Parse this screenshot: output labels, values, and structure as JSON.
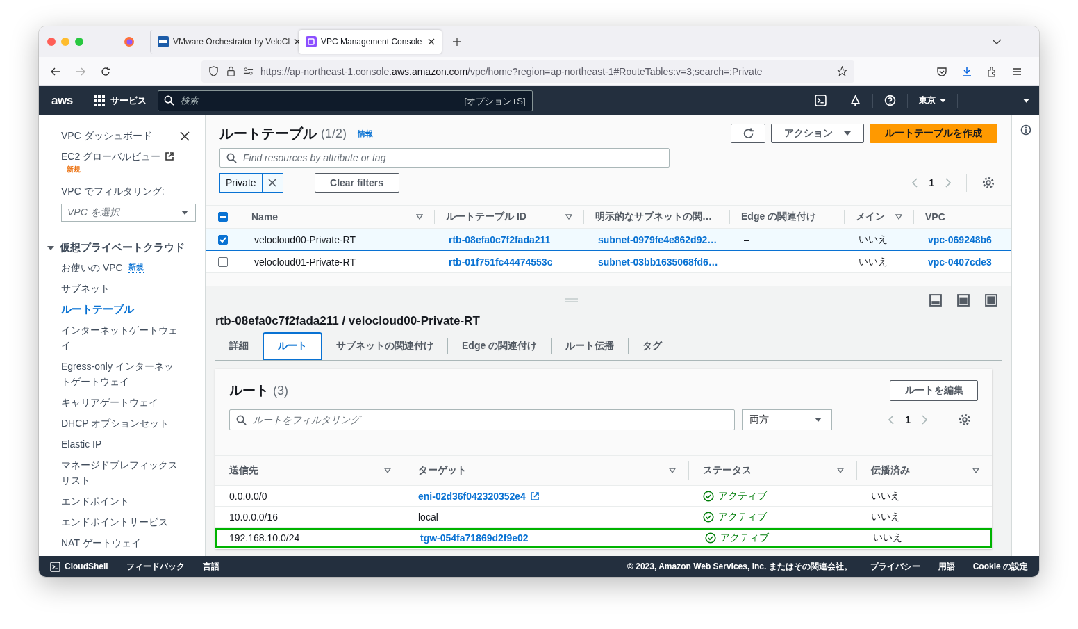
{
  "browser": {
    "tabs": [
      {
        "title": "VMware Orchestrator by VeloCl",
        "selected": false
      },
      {
        "title": "VPC Management Console",
        "selected": true
      }
    ],
    "url": "https://ap-northeast-1.console.**aws.amazon.com**/vpc/home?region=ap-northeast-1#RouteTables:v=3;search=:Private"
  },
  "topnav": {
    "logo": "aws",
    "services": "サービス",
    "search_placeholder": "検索",
    "search_shortcut": "[オプション+S]",
    "region": "東京"
  },
  "sidebar": {
    "items": [
      {
        "label": "VPC ダッシュボード",
        "kind": "link"
      },
      {
        "label": "EC2 グローバルビュー",
        "kind": "external",
        "badge": "新規"
      }
    ],
    "filter_label": "VPC でフィルタリング:",
    "filter_placeholder": "VPC を選択",
    "section": {
      "label": "仮想プライベートクラウド",
      "expanded": true,
      "children": [
        {
          "label": "お使いの VPC",
          "badge": "新規",
          "selected": false
        },
        {
          "label": "サブネット",
          "selected": false
        },
        {
          "label": "ルートテーブル",
          "selected": true
        },
        {
          "label": "インターネットゲートウェイ",
          "selected": false
        },
        {
          "label": "Egress-only インターネットゲートウェイ",
          "selected": false
        },
        {
          "label": "キャリアゲートウェイ",
          "selected": false
        },
        {
          "label": "DHCP オプションセット",
          "selected": false
        },
        {
          "label": "Elastic IP",
          "selected": false
        },
        {
          "label": "マネージドプレフィックスリスト",
          "selected": false
        },
        {
          "label": "エンドポイント",
          "selected": false
        },
        {
          "label": "エンドポイントサービス",
          "selected": false
        },
        {
          "label": "NAT ゲートウェイ",
          "selected": false
        }
      ]
    }
  },
  "route_tables": {
    "title": "ルートテーブル",
    "count": "(1/2)",
    "info": "情報",
    "actions": "アクション",
    "create": "ルートテーブルを作成",
    "select_all_partial": true,
    "search_placeholder": "Find resources by attribute or tag",
    "filter_token": "Private",
    "clear_filters": "Clear filters",
    "page": "1",
    "columns": [
      {
        "label": "Name",
        "sortable": true
      },
      {
        "label": "ルートテーブル ID",
        "sortable": true
      },
      {
        "label": "明示的なサブネットの関…",
        "sortable": false
      },
      {
        "label": "Edge の関連付け",
        "sortable": false
      },
      {
        "label": "メイン",
        "sortable": true
      },
      {
        "label": "VPC",
        "sortable": false
      }
    ],
    "rows": [
      {
        "selected": true,
        "name": "velocloud00-Private-RT",
        "id": "rtb-08efa0c7f2fada211",
        "subnet": "subnet-0979fe4e862d92…",
        "edge": "–",
        "main": "いいえ",
        "vpc": "vpc-069248b6"
      },
      {
        "selected": false,
        "name": "velocloud01-Private-RT",
        "id": "rtb-01f751fc44474553c",
        "subnet": "subnet-03bb1635068fd6…",
        "edge": "–",
        "main": "いいえ",
        "vpc": "vpc-0407cde3"
      }
    ]
  },
  "details": {
    "title": "rtb-08efa0c7f2fada211 / velocloud00-Private-RT",
    "tabs": [
      {
        "label": "詳細",
        "selected": false
      },
      {
        "label": "ルート",
        "selected": true
      },
      {
        "label": "サブネットの関連付け",
        "selected": false
      },
      {
        "label": "Edge の関連付け",
        "selected": false
      },
      {
        "label": "ルート伝播",
        "selected": false
      },
      {
        "label": "タグ",
        "selected": false
      }
    ],
    "routes": {
      "title": "ルート",
      "count": "(3)",
      "edit_button": "ルートを編集",
      "filter_placeholder": "ルートをフィルタリング",
      "select_value": "両方",
      "page": "1",
      "columns": [
        {
          "label": "送信先",
          "sortable": true
        },
        {
          "label": "ターゲット",
          "sortable": true
        },
        {
          "label": "ステータス",
          "sortable": true
        },
        {
          "label": "伝播済み",
          "sortable": true
        }
      ],
      "rows": [
        {
          "destination": "0.0.0.0/0",
          "target": "eni-02d36f042320352e4",
          "link": true,
          "external": true,
          "status": "アクティブ",
          "propagated": "いいえ",
          "highlighted": false
        },
        {
          "destination": "10.0.0.0/16",
          "target": "local",
          "link": false,
          "external": false,
          "status": "アクティブ",
          "propagated": "いいえ",
          "highlighted": false
        },
        {
          "destination": "192.168.10.0/24",
          "target": "tgw-054fa71869d2f9e02",
          "link": true,
          "external": false,
          "status": "アクティブ",
          "propagated": "いいえ",
          "highlighted": true
        }
      ]
    }
  },
  "footer": {
    "cloudshell": "CloudShell",
    "feedback": "フィードバック",
    "language": "言語",
    "copyright": "© 2023, Amazon Web Services, Inc. またはその関連会社。",
    "links": [
      "プライバシー",
      "用語",
      "Cookie の設定"
    ]
  }
}
